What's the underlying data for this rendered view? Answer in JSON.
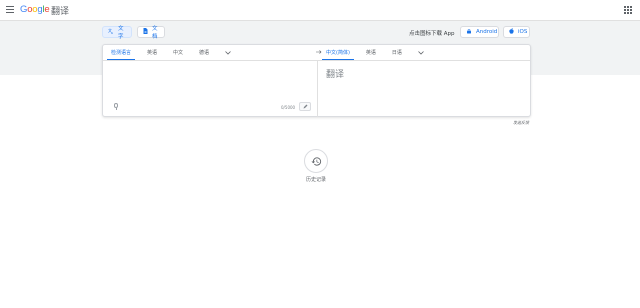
{
  "header": {
    "logo": "Google",
    "product": "翻译"
  },
  "modes": {
    "text_label": "文字",
    "docs_label": "文档"
  },
  "apps": {
    "prompt": "点击图标下载 App",
    "android_label": "Android",
    "ios_label": "iOS"
  },
  "source_langs": [
    "检测语言",
    "英语",
    "中文",
    "德语"
  ],
  "target_langs": [
    "中文(简体)",
    "英语",
    "日语"
  ],
  "source": {
    "value": "",
    "char_count": "0/5000"
  },
  "target": {
    "placeholder": "翻译"
  },
  "feedback": "发送反馈",
  "history": {
    "label": "历史记录"
  },
  "colors": {
    "accent": "#1a73e8",
    "band": "#f1f3f4"
  },
  "logo_colors": [
    "#4285f4",
    "#ea4335",
    "#fbbc05",
    "#4285f4",
    "#34a853",
    "#ea4335"
  ],
  "icons": [
    "menu-icon",
    "apps-icon",
    "translate-icon",
    "document-icon",
    "android-icon",
    "apple-icon",
    "swap-icon",
    "chevron-down-icon",
    "mic-icon",
    "pen-icon",
    "history-icon"
  ]
}
